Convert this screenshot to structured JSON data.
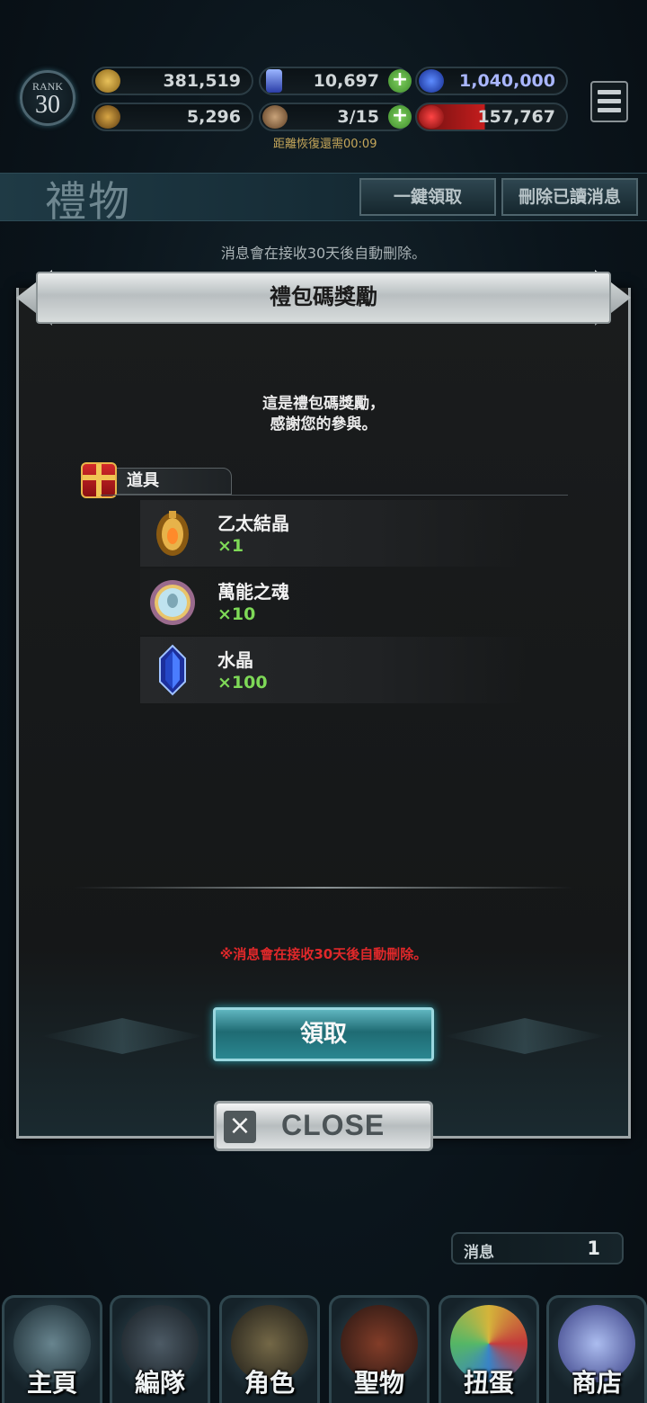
{
  "hud": {
    "rank_label": "RANK",
    "rank_value": "30",
    "gold": "381,519",
    "crystal": "10,697",
    "blue_points": "1,040,000",
    "trophy": "5,296",
    "stamina": "3/15",
    "red_points": "157,767",
    "recover_text": "距離恢復還需00:09"
  },
  "page": {
    "title": "禮物",
    "claim_all_label": "一鍵領取",
    "delete_read_label": "刪除已讀消息",
    "auto_delete_notice": "消息會在接收30天後自動刪除。"
  },
  "dialog": {
    "title": "禮包碼獎勵",
    "message_line1": "這是禮包碼獎勵，",
    "message_line2": "感謝您的參與。",
    "category_label": "道具",
    "items": [
      {
        "name": "乙太結晶",
        "qty": "×1",
        "icon": "ether-crystal-icon"
      },
      {
        "name": "萬能之魂",
        "qty": "×10",
        "icon": "universal-soul-icon"
      },
      {
        "name": "水晶",
        "qty": "×100",
        "icon": "crystal-icon"
      }
    ],
    "warning": "※消息會在接收30天後自動刪除。",
    "claim_label": "領取",
    "close_label": "CLOSE"
  },
  "messages": {
    "label": "消息",
    "count": "1"
  },
  "nav": [
    {
      "label": "主頁"
    },
    {
      "label": "編隊"
    },
    {
      "label": "角色"
    },
    {
      "label": "聖物"
    },
    {
      "label": "扭蛋"
    },
    {
      "label": "商店"
    }
  ],
  "colors": {
    "qty_green": "#7ed957",
    "warning_red": "#e0282a",
    "claim_teal": "#2a8690"
  }
}
